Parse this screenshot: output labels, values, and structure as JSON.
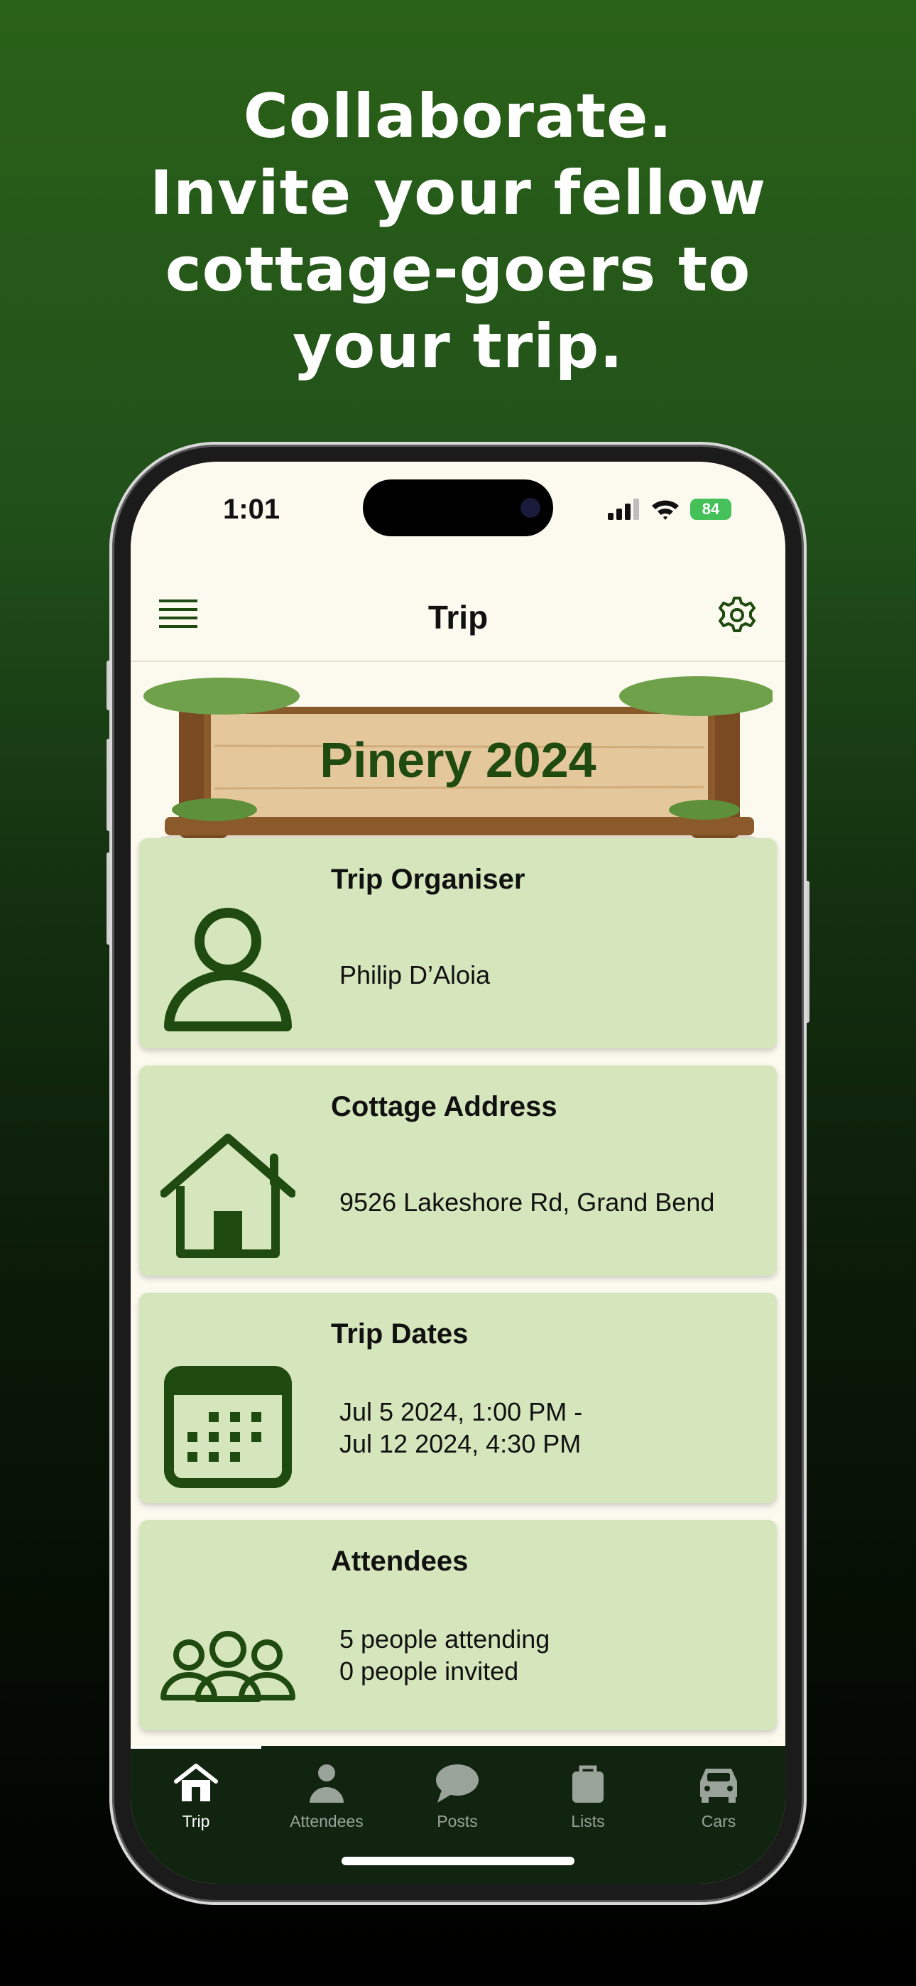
{
  "headline": {
    "line1": "Collaborate.",
    "line2": "Invite your fellow",
    "line3": "cottage-goers to",
    "line4": "your trip."
  },
  "status_bar": {
    "time": "1:01",
    "battery": "84"
  },
  "header": {
    "title": "Trip",
    "left_icon": "menu-icon",
    "right_icon": "gear-icon"
  },
  "banner": {
    "title": "Pinery 2024"
  },
  "cards": [
    {
      "title": "Trip Organiser",
      "lines": [
        "Philip D’Aloia"
      ],
      "icon": "person-icon"
    },
    {
      "title": "Cottage Address",
      "lines": [
        "9526 Lakeshore Rd, Grand Bend"
      ],
      "icon": "house-icon"
    },
    {
      "title": "Trip Dates",
      "lines": [
        "Jul 5 2024, 1:00 PM -",
        "Jul 12 2024, 4:30 PM"
      ],
      "icon": "calendar-icon"
    },
    {
      "title": "Attendees",
      "lines": [
        "5 people attending",
        "0 people invited"
      ],
      "icon": "group-icon"
    }
  ],
  "tabs": [
    {
      "label": "Trip",
      "icon": "home-icon",
      "active": true
    },
    {
      "label": "Attendees",
      "icon": "person-icon",
      "active": false
    },
    {
      "label": "Posts",
      "icon": "chat-bubble-icon",
      "active": false
    },
    {
      "label": "Lists",
      "icon": "bag-icon",
      "active": false
    },
    {
      "label": "Cars",
      "icon": "car-icon",
      "active": false
    }
  ],
  "colors": {
    "accent": "#1f4a10",
    "card_bg": "#d6e6bc",
    "screen_bg": "#fcf9ef",
    "tabbar_bg": "#102410"
  }
}
